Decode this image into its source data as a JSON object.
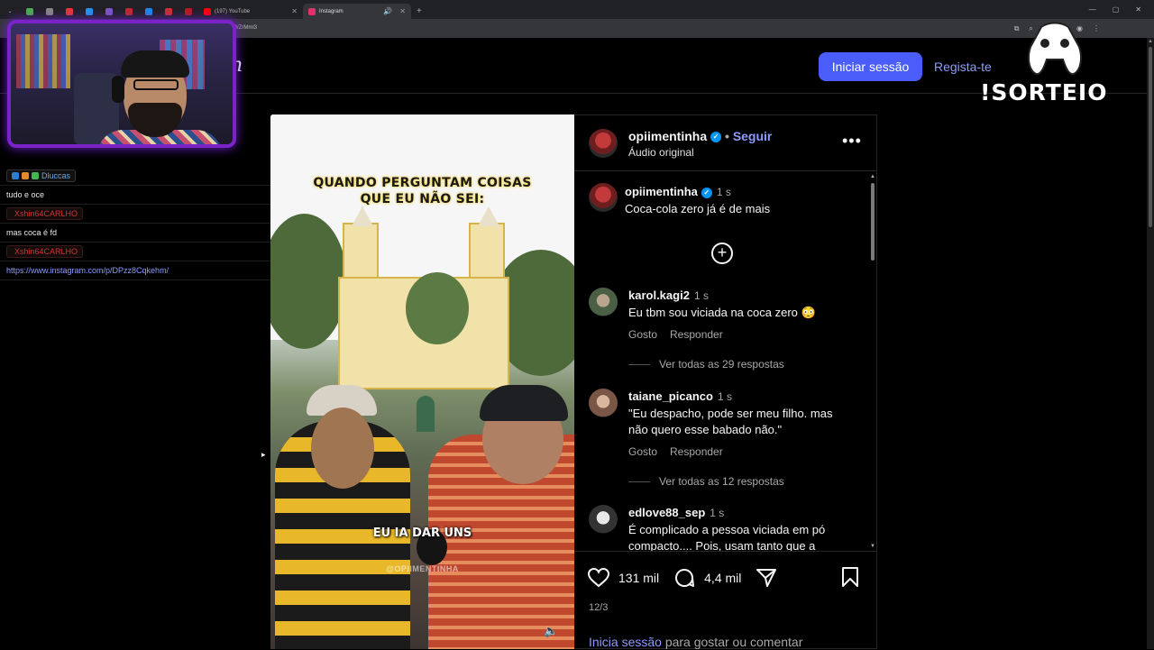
{
  "browser": {
    "tabs": [
      {
        "title": "",
        "color": "#666"
      },
      {
        "title": "",
        "color": "#4caf50"
      },
      {
        "title": "",
        "color": "#888"
      },
      {
        "title": "",
        "color": "#e53935"
      },
      {
        "title": "",
        "color": "#2196f3"
      },
      {
        "title": "",
        "color": "#7e57c2"
      },
      {
        "title": "",
        "color": "#c62828"
      },
      {
        "title": "",
        "color": "#1e88e5"
      },
      {
        "title": "",
        "color": "#d32f2f"
      },
      {
        "title": "",
        "color": "#b71c1c"
      },
      {
        "title": "(197) YouTube",
        "color": "#ff0000"
      },
      {
        "title": "Instagram",
        "color": "#e1306c"
      }
    ],
    "url": "...YWZrMml3",
    "new_tab": "+"
  },
  "header": {
    "logo_fragment": "n",
    "login_button": "Iniciar sessão",
    "signup_link": "Regista-te"
  },
  "video": {
    "top_caption_line1": "QUANDO PERGUNTAM COISAS",
    "top_caption_line2": "QUE EU NÃO SEI:",
    "mid_caption": "EU IA DAR UNS",
    "watermark": "@OPIIMENTINHA"
  },
  "post": {
    "author": "opiimentinha",
    "follow": "Seguir",
    "audio": "Áudio original",
    "caption_author": "opiimentinha",
    "caption_time": "1 s",
    "caption_text": "Coca-cola zero já é de mais",
    "comments": [
      {
        "user": "karol.kagi2",
        "time": "1 s",
        "text": "Eu tbm sou viciada na coca zero 😳",
        "like": "Gosto",
        "reply": "Responder",
        "view_all": "Ver todas as 29 respostas"
      },
      {
        "user": "taiane_picanco",
        "time": "1 s",
        "text": "\"Eu despacho, pode ser meu filho. mas não quero esse babado não.\"",
        "like": "Gosto",
        "reply": "Responder",
        "view_all": "Ver todas as 12 respostas"
      },
      {
        "user": "edlove88_sep",
        "time": "1 s",
        "text": "É complicado a pessoa viciada em pó compacto.... Pois, usam tanto que a"
      }
    ],
    "likes": "131 mil",
    "comments_count": "4,4 mil",
    "date": "12/3",
    "footer_link": "Inicia sessão",
    "footer_text": " para gostar ou comentar"
  },
  "chat": {
    "messages": [
      {
        "user": "Dluccas",
        "text": "tudo e oce",
        "user_color": "#6aa9e6"
      },
      {
        "user": "Xshin64CARLHO",
        "text": "mas coca é fd",
        "user_color": "#d33232"
      },
      {
        "user": "Xshin64CARLHO",
        "text": "https://www.instagram.com/p/DPzz8Cqkehm/",
        "user_color": "#d33232"
      }
    ]
  },
  "overlay": {
    "giveaway": "!SORTEIO"
  },
  "colors": {
    "accent": "#4a5df9",
    "link": "#8c9bff",
    "background": "#000000",
    "webcam_border": "#7b22c9"
  }
}
